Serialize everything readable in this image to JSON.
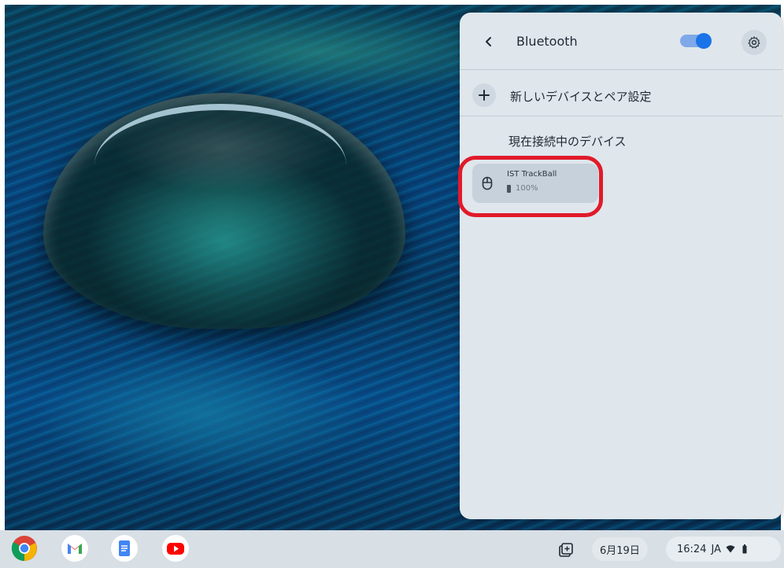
{
  "bluetooth_panel": {
    "title": "Bluetooth",
    "toggle_on": true,
    "pair_new_label": "新しいデバイスとペア設定",
    "connected_section_label": "現在接続中のデバイス",
    "devices": [
      {
        "name": "IST TrackBall",
        "battery": "100%",
        "icon": "mouse-icon"
      }
    ],
    "accent_color": "#1a73e8",
    "highlight_color": "#e11a2a"
  },
  "shelf": {
    "apps": [
      {
        "name": "Chrome",
        "icon": "chrome-icon"
      },
      {
        "name": "Gmail",
        "icon": "gmail-icon"
      },
      {
        "name": "Docs",
        "icon": "docs-icon"
      },
      {
        "name": "YouTube",
        "icon": "youtube-icon"
      }
    ],
    "date": "6月19日",
    "time": "16:24",
    "ime": "JA"
  }
}
